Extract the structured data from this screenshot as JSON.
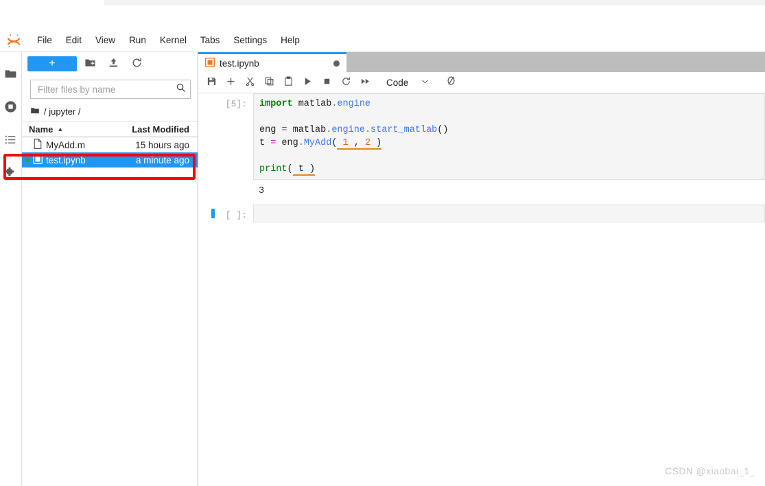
{
  "app": {
    "title": "JupyterLab",
    "logo_icon": "jupyter-logo-icon"
  },
  "browser_sliver": {
    "ghost_labels": [
      "·",
      "·  ·",
      "·  ·",
      "· ·"
    ]
  },
  "menubar": {
    "items": [
      {
        "label": "File",
        "name": "menu-file"
      },
      {
        "label": "Edit",
        "name": "menu-edit"
      },
      {
        "label": "View",
        "name": "menu-view"
      },
      {
        "label": "Run",
        "name": "menu-run"
      },
      {
        "label": "Kernel",
        "name": "menu-kernel"
      },
      {
        "label": "Tabs",
        "name": "menu-tabs"
      },
      {
        "label": "Settings",
        "name": "menu-settings"
      },
      {
        "label": "Help",
        "name": "menu-help"
      }
    ]
  },
  "activitybar": {
    "items": [
      {
        "icon": "folder-icon",
        "name": "sidebar-tab-file-browser",
        "active": true
      },
      {
        "icon": "stop-circle-icon",
        "name": "sidebar-tab-running-terminals",
        "active": false
      },
      {
        "icon": "list-icon",
        "name": "sidebar-tab-commands",
        "active": false
      },
      {
        "icon": "puzzle-icon",
        "name": "sidebar-tab-extensions",
        "active": false
      }
    ]
  },
  "filebrowser": {
    "new_launcher_label": "+",
    "toolbar": [
      {
        "icon": "new-folder-icon",
        "name": "new-folder-button"
      },
      {
        "icon": "upload-icon",
        "name": "upload-files-button"
      },
      {
        "icon": "refresh-icon",
        "name": "refresh-file-list-button"
      }
    ],
    "filter": {
      "value": "",
      "placeholder": "Filter files by name"
    },
    "breadcrumb": {
      "root_icon": "folder-icon",
      "path": "/ jupyter /"
    },
    "columns": {
      "name": "Name",
      "last_modified": "Last Modified",
      "sort_indicator": "▲"
    },
    "files": [
      {
        "name": "MyAdd.m",
        "modified": "15 hours ago",
        "icon": "file-icon",
        "selected": false,
        "running": false
      },
      {
        "name": "test.ipynb",
        "modified": "a minute ago",
        "icon": "notebook-icon",
        "selected": true,
        "running": true
      }
    ]
  },
  "notebook": {
    "tab": {
      "label": "test.ipynb",
      "icon": "notebook-icon",
      "dirty": true
    },
    "toolbar": {
      "buttons": [
        {
          "icon": "save-icon",
          "name": "save-button"
        },
        {
          "icon": "add-cell-icon",
          "name": "insert-cell-button"
        },
        {
          "icon": "cut-icon",
          "name": "cut-cells-button"
        },
        {
          "icon": "copy-icon",
          "name": "copy-cells-button"
        },
        {
          "icon": "paste-icon",
          "name": "paste-cells-button"
        },
        {
          "icon": "run-icon",
          "name": "run-cell-button"
        },
        {
          "icon": "stop-icon",
          "name": "interrupt-kernel-button"
        },
        {
          "icon": "restart-icon",
          "name": "restart-kernel-button"
        },
        {
          "icon": "fast-forward-icon",
          "name": "restart-and-run-all-button"
        }
      ],
      "cell_type": {
        "value": "Code",
        "chevron": "chevron-down-icon"
      },
      "kernel_status_icon": "kernel-idle-circle-icon"
    },
    "cells": [
      {
        "prompt": "[5]:",
        "active": false,
        "lines": [
          [
            {
              "t": "import",
              "c": "kw"
            },
            {
              "t": " matlab",
              "c": "pl"
            },
            {
              "t": ".engine",
              "c": "prop"
            }
          ],
          [],
          [
            {
              "t": "eng ",
              "c": "pl"
            },
            {
              "t": "=",
              "c": "op"
            },
            {
              "t": " matlab",
              "c": "pl"
            },
            {
              "t": ".engine",
              "c": "prop"
            },
            {
              "t": ".start_matlab",
              "c": "prop"
            },
            {
              "t": "()",
              "c": "pl"
            }
          ],
          [
            {
              "t": "t ",
              "c": "pl"
            },
            {
              "t": "=",
              "c": "op"
            },
            {
              "t": " eng",
              "c": "pl"
            },
            {
              "t": ".MyAdd",
              "c": "prop"
            },
            {
              "t": "(",
              "c": "pl"
            },
            {
              "t": " 1 ",
              "c": "num-spell"
            },
            {
              "t": ",",
              "c": "pl-spell"
            },
            {
              "t": " 2 ",
              "c": "num-spell"
            },
            {
              "t": ")",
              "c": "pl-spell"
            }
          ],
          [],
          [
            {
              "t": "print",
              "c": "bi"
            },
            {
              "t": "(",
              "c": "pl"
            },
            {
              "t": " t ",
              "c": "pl-spell"
            },
            {
              "t": ")",
              "c": "pl-spell"
            }
          ]
        ],
        "output": "3"
      },
      {
        "prompt": "[ ]:",
        "active": true,
        "lines": [],
        "output": null
      }
    ]
  },
  "annotation": {
    "shape": "rectangle",
    "color": "#ff0000",
    "target": "file-row-test-ipynb"
  },
  "watermark": {
    "text": "CSDN @xiaobai_1_"
  },
  "colors": {
    "accent_blue": "#2196f3",
    "tabbar_gray": "#bdbdbd",
    "cell_bg": "#f5f5f5",
    "annotation_red": "#ff0000",
    "running_green": "#31a231"
  }
}
